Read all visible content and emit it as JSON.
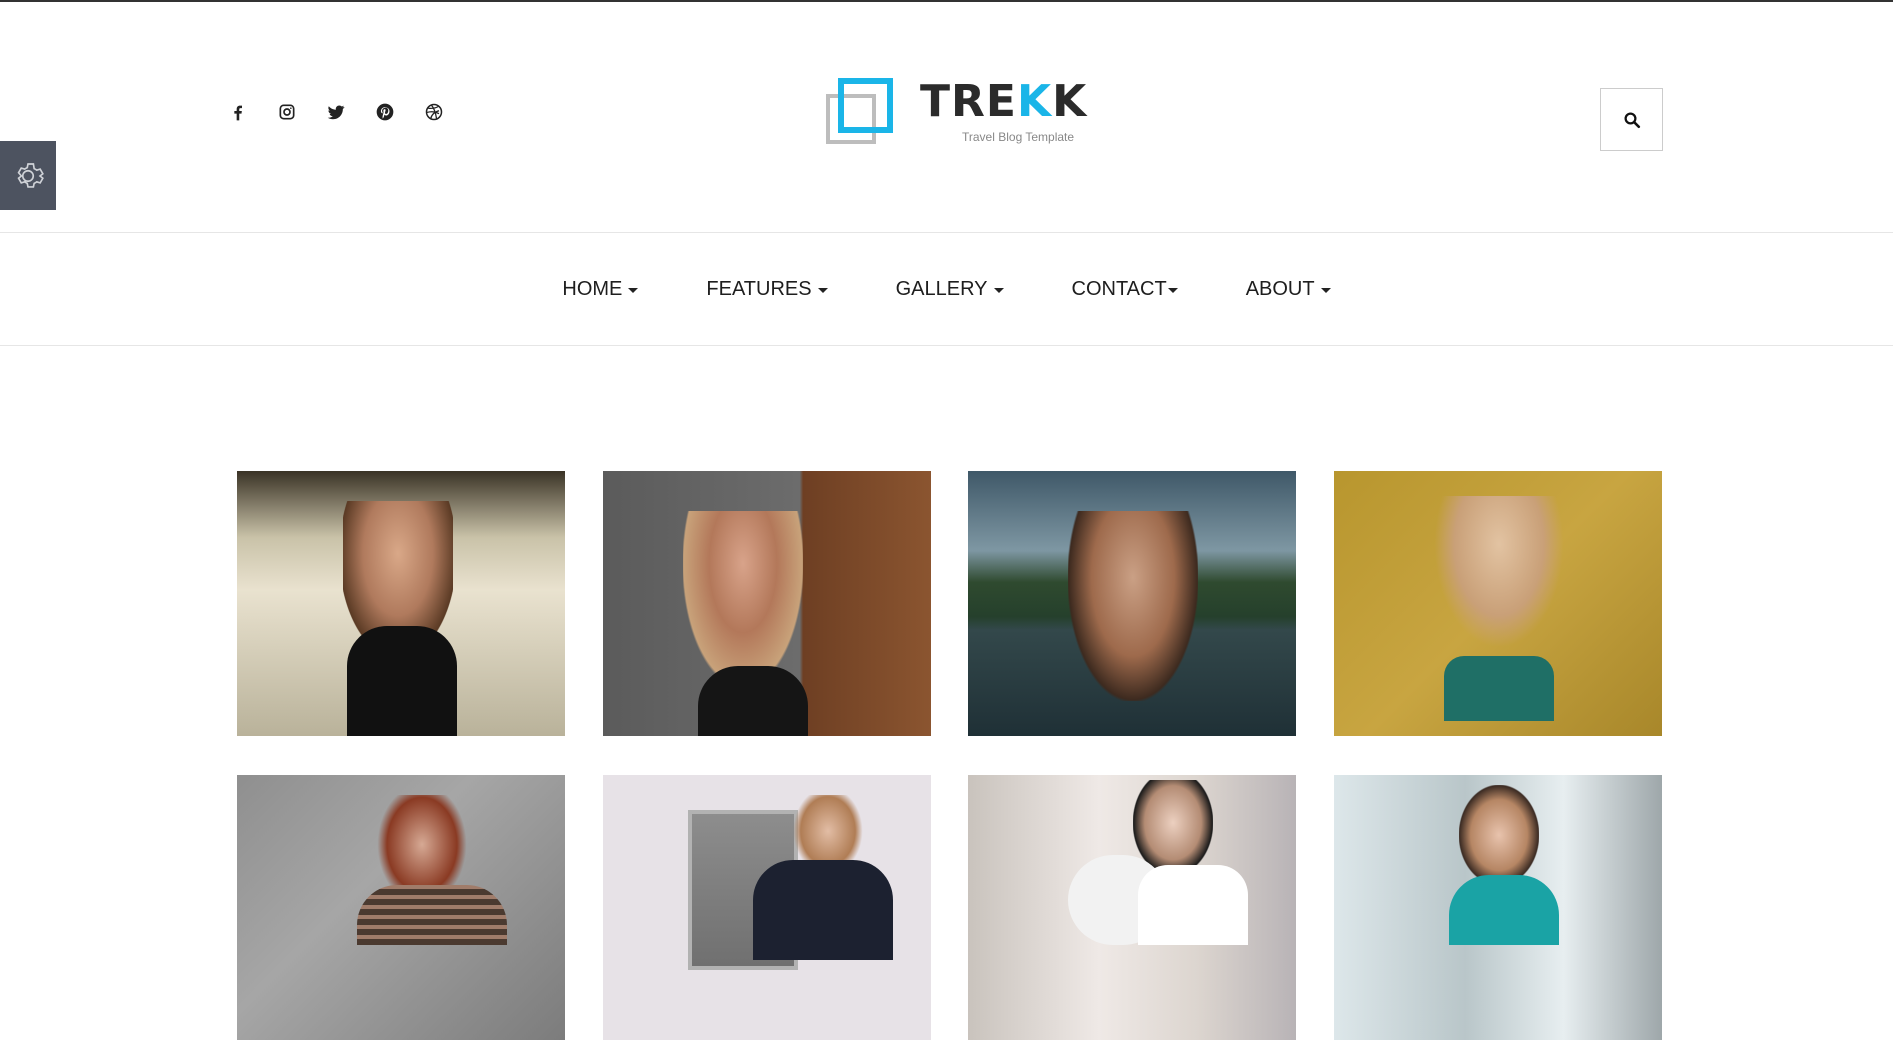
{
  "header": {
    "social": [
      {
        "name": "facebook-icon"
      },
      {
        "name": "instagram-icon"
      },
      {
        "name": "twitter-icon"
      },
      {
        "name": "pinterest-icon"
      },
      {
        "name": "dribbble-icon"
      }
    ],
    "logo": {
      "word_a": "TRE",
      "word_b": "K",
      "word_c": "K",
      "tagline": "Travel Blog Template"
    },
    "search_icon": "search-icon",
    "settings_icon": "gear-icon"
  },
  "nav": {
    "items": [
      {
        "label": "HOME"
      },
      {
        "label": "FEATURES"
      },
      {
        "label": "GALLERY"
      },
      {
        "label": "CONTACT"
      },
      {
        "label": "ABOUT"
      }
    ]
  },
  "gallery": {
    "photos": [
      {
        "alt": "woman-sunglasses-street"
      },
      {
        "alt": "woman-sunglasses-wall"
      },
      {
        "alt": "woman-in-water"
      },
      {
        "alt": "woman-yellow-wall"
      },
      {
        "alt": "woman-red-hair"
      },
      {
        "alt": "woman-phone-booth"
      },
      {
        "alt": "woman-with-dog"
      },
      {
        "alt": "woman-teal-top"
      }
    ]
  },
  "colors": {
    "accent": "#1ab5e8",
    "settings_bg": "#4d5360",
    "text": "#1e1e1e"
  }
}
